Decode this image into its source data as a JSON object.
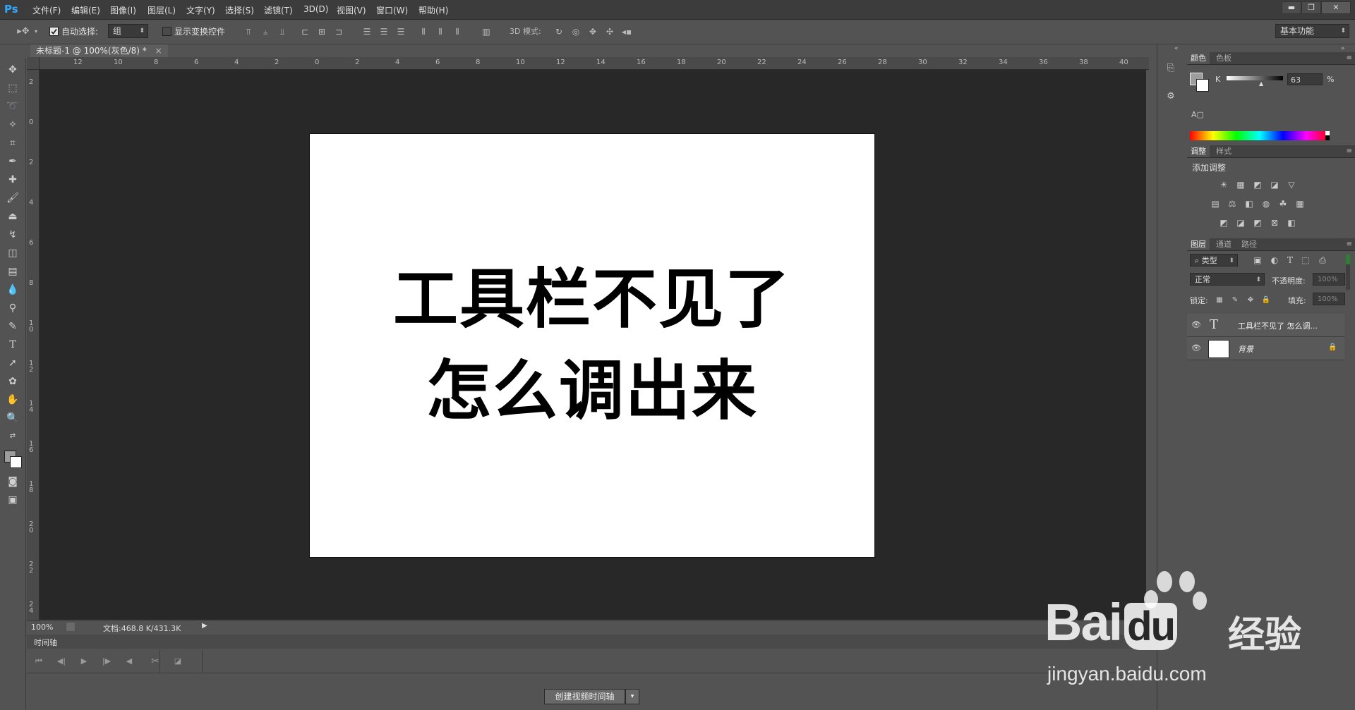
{
  "app": {
    "logo": "Ps"
  },
  "menu": [
    "文件(F)",
    "编辑(E)",
    "图像(I)",
    "图层(L)",
    "文字(Y)",
    "选择(S)",
    "滤镜(T)",
    "3D(D)",
    "视图(V)",
    "窗口(W)",
    "帮助(H)"
  ],
  "window_controls": {
    "minimize": "▬",
    "restore": "❐",
    "close": "✕"
  },
  "options": {
    "auto_select_label": "自动选择:",
    "auto_select_value": "组",
    "show_transform_label": "显示变换控件",
    "mode_3d_label": "3D 模式:",
    "workspace": "基本功能"
  },
  "document": {
    "tab_title": "未标题-1 @ 100%(灰色/8) *",
    "tab_close": "×",
    "canvas_lines": [
      "工具栏不见了",
      "怎么调出来"
    ],
    "ruler_top": [
      "12",
      "10",
      "8",
      "6",
      "4",
      "2",
      "0",
      "2",
      "4",
      "6",
      "8",
      "10",
      "12",
      "14",
      "16",
      "18",
      "20",
      "22",
      "24",
      "26",
      "28",
      "30",
      "32",
      "34",
      "36",
      "38",
      "40"
    ],
    "ruler_left": [
      "2",
      "0",
      "2",
      "4",
      "6",
      "8",
      "1\n0",
      "1\n2",
      "1\n4",
      "1\n6",
      "1\n8",
      "2\n0",
      "2\n2",
      "2\n4"
    ]
  },
  "status": {
    "zoom": "100%",
    "doc_size": "文档:468.8 K/431.3K"
  },
  "timeline": {
    "tab_label": "时间轴",
    "create_button": "创建视频时间轴",
    "create_arrow": "▾"
  },
  "color_panel": {
    "tabs": [
      "颜色",
      "色板"
    ],
    "channel_label": "K",
    "value": "63",
    "unit": "%"
  },
  "adjust_panel": {
    "tabs": [
      "调整",
      "样式"
    ],
    "title": "添加调整"
  },
  "layers_panel": {
    "tabs": [
      "图层",
      "通道",
      "路径"
    ],
    "filter_kind": "类型",
    "blend_mode": "正常",
    "opacity_label": "不透明度:",
    "opacity_value": "100%",
    "lock_label": "锁定:",
    "fill_label": "填充:",
    "fill_value": "100%",
    "layers": [
      {
        "type": "text",
        "name": "工具栏不见了 怎么调...",
        "thumb": "T"
      },
      {
        "type": "background",
        "name": "背景"
      }
    ]
  },
  "watermark": {
    "brand": "Bai",
    "brand_tail": "du",
    "cn": "经验",
    "url": "jingyan.baidu.com"
  }
}
